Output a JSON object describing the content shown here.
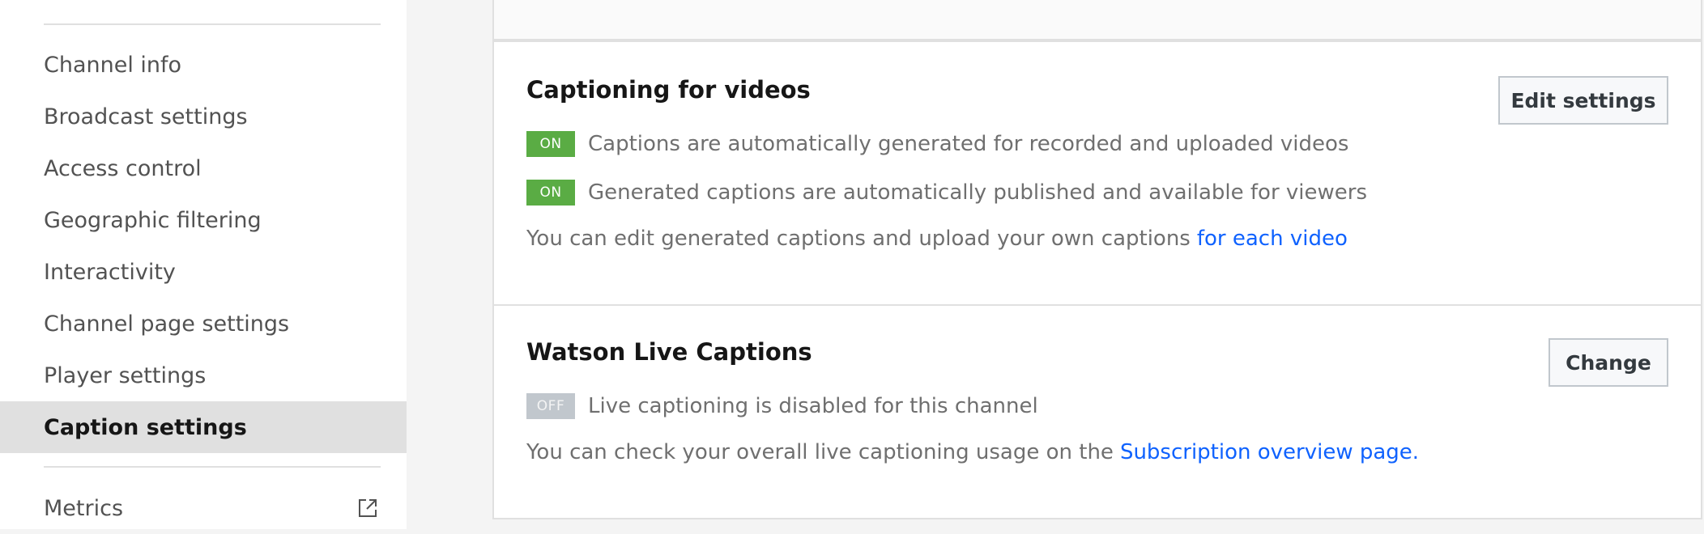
{
  "sidebar": {
    "items": [
      {
        "label": "Channel info"
      },
      {
        "label": "Broadcast settings"
      },
      {
        "label": "Access control"
      },
      {
        "label": "Geographic filtering"
      },
      {
        "label": "Interactivity"
      },
      {
        "label": "Channel page settings"
      },
      {
        "label": "Player settings"
      },
      {
        "label": "Caption settings"
      }
    ],
    "metrics_label": "Metrics",
    "metrics_icon": "external-link-icon"
  },
  "captioning": {
    "title": "Captioning for videos",
    "edit_button": "Edit settings",
    "row1": {
      "badge": "ON",
      "text": "Captions are automatically generated for recorded and uploaded videos"
    },
    "row2": {
      "badge": "ON",
      "text": "Generated captions are automatically published and available for viewers"
    },
    "note": "You can edit generated captions and upload your own captions",
    "note_link": "for each video"
  },
  "watson": {
    "title": "Watson Live Captions",
    "change_button": "Change",
    "row1": {
      "badge": "OFF",
      "text": "Live captioning is disabled for this channel"
    },
    "note": "You can check your overall live captioning usage on the",
    "note_link": "Subscription overview page."
  },
  "colors": {
    "on_badge": "#5aac44",
    "off_badge": "#c1c7cd",
    "link": "#0f62fe",
    "active_nav_bg": "#e0e0e0"
  }
}
